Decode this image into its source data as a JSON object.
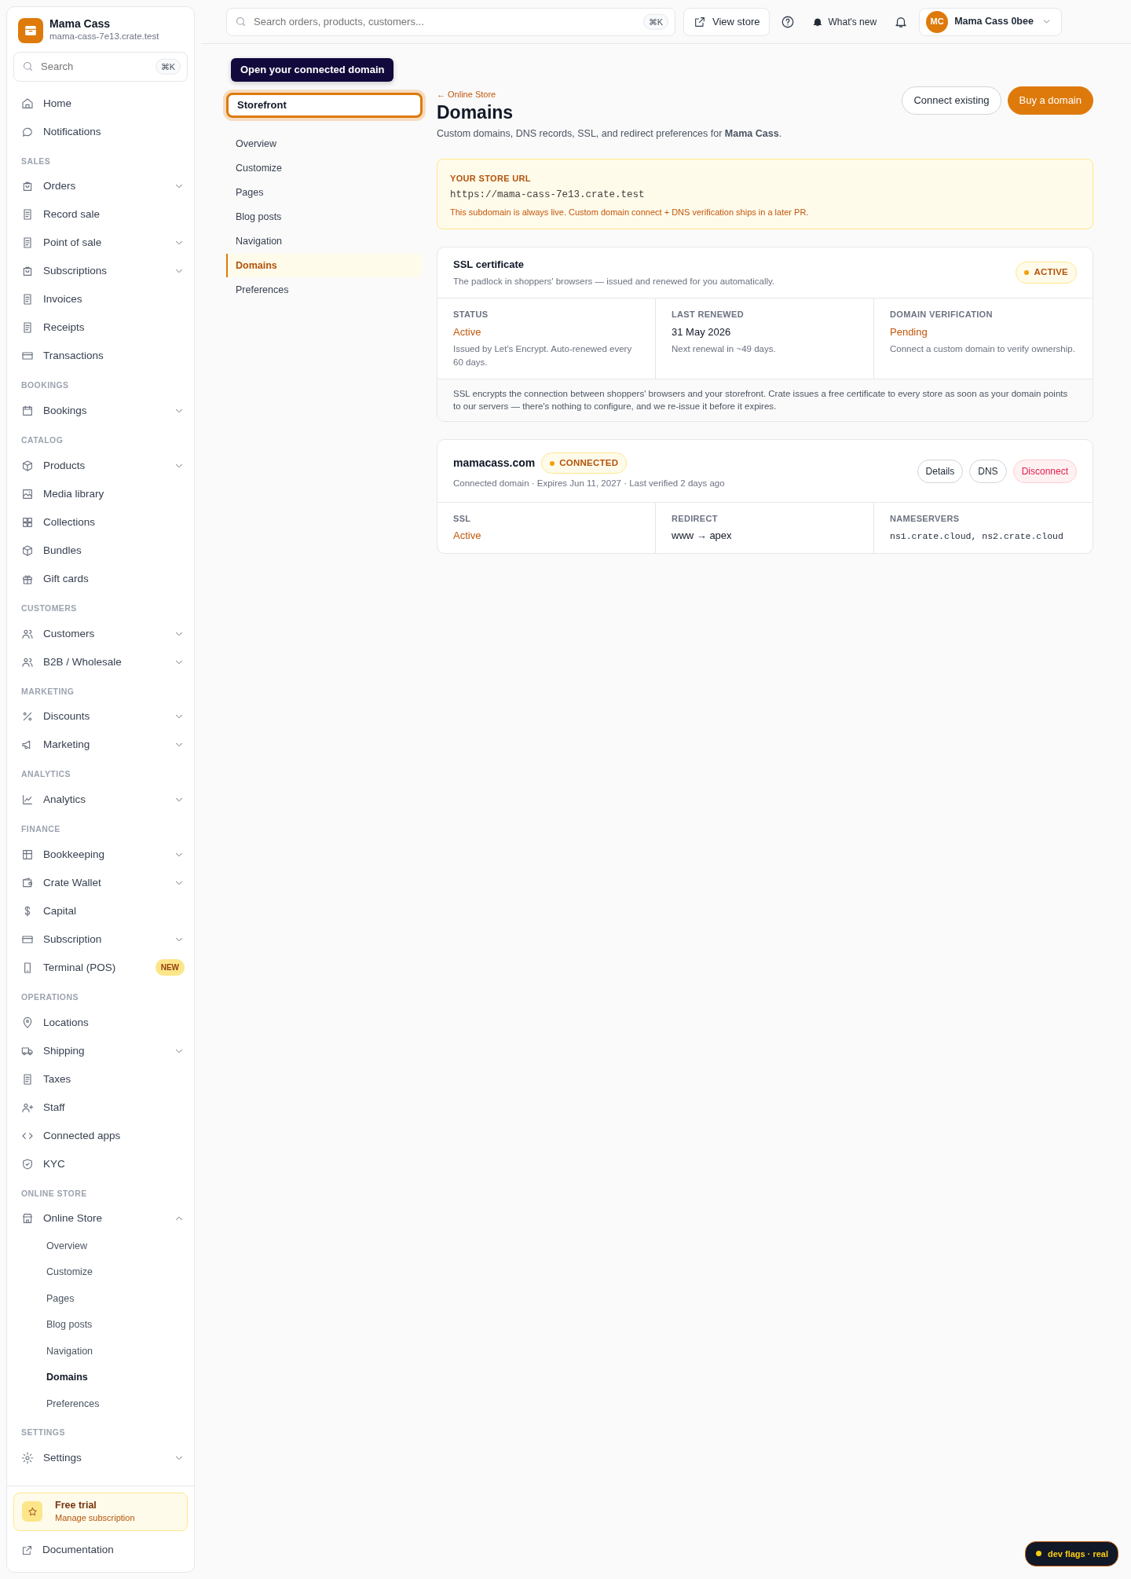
{
  "sidebar": {
    "store": {
      "name": "Mama Cass",
      "url": "mama-cass-7e13.crate.test"
    },
    "search": {
      "placeholder": "Search",
      "shortcut": "⌘K"
    },
    "sections": [
      {
        "items": [
          {
            "label": "Home",
            "selected": false
          },
          {
            "label": "Notifications",
            "selected": false
          }
        ]
      },
      {
        "label": "SALES",
        "items": [
          {
            "label": "Orders",
            "selected": false,
            "expanded": false
          },
          {
            "label": "Record sale",
            "selected": false
          },
          {
            "label": "Point of sale",
            "selected": false,
            "expanded": false
          },
          {
            "label": "Subscriptions",
            "selected": false,
            "expanded": false
          },
          {
            "label": "Invoices",
            "selected": false
          },
          {
            "label": "Receipts",
            "selected": false
          },
          {
            "label": "Transactions",
            "selected": false
          }
        ]
      },
      {
        "label": "BOOKINGS",
        "items": [
          {
            "label": "Bookings",
            "selected": false,
            "expanded": false
          }
        ]
      },
      {
        "label": "CATALOG",
        "items": [
          {
            "label": "Products",
            "selected": false,
            "expanded": false
          },
          {
            "label": "Media library",
            "selected": false
          },
          {
            "label": "Collections",
            "selected": false
          },
          {
            "label": "Bundles",
            "selected": false
          },
          {
            "label": "Gift cards",
            "selected": false
          }
        ]
      },
      {
        "label": "CUSTOMERS",
        "items": [
          {
            "label": "Customers",
            "selected": false,
            "expanded": false
          },
          {
            "label": "B2B / Wholesale",
            "selected": false,
            "expanded": false
          }
        ]
      },
      {
        "label": "MARKETING",
        "items": [
          {
            "label": "Discounts",
            "selected": false,
            "expanded": false
          },
          {
            "label": "Marketing",
            "selected": false,
            "expanded": false
          }
        ]
      },
      {
        "label": "ANALYTICS",
        "items": [
          {
            "label": "Analytics",
            "selected": false,
            "expanded": false
          }
        ]
      },
      {
        "label": "FINANCE",
        "items": [
          {
            "label": "Bookkeeping",
            "selected": false,
            "expanded": false
          },
          {
            "label": "Crate Wallet",
            "selected": false,
            "expanded": false
          },
          {
            "label": "Capital",
            "selected": false
          },
          {
            "label": "Subscription",
            "selected": false,
            "expanded": false
          },
          {
            "label": "Terminal (POS)",
            "selected": false,
            "badge": "NEW"
          }
        ]
      },
      {
        "label": "OPERATIONS",
        "items": [
          {
            "label": "Locations",
            "selected": false
          },
          {
            "label": "Shipping",
            "selected": false,
            "expanded": false
          },
          {
            "label": "Taxes",
            "selected": false
          },
          {
            "label": "Staff",
            "selected": false
          },
          {
            "label": "Connected apps",
            "selected": false
          },
          {
            "label": "KYC",
            "selected": false
          }
        ]
      },
      {
        "label": "ONLINE STORE",
        "items": [
          {
            "label": "Online Store",
            "selected": false,
            "expanded": true,
            "children": [
              {
                "label": "Overview",
                "selected": false
              },
              {
                "label": "Customize",
                "selected": false
              },
              {
                "label": "Pages",
                "selected": false
              },
              {
                "label": "Blog posts",
                "selected": false
              },
              {
                "label": "Navigation",
                "selected": false
              },
              {
                "label": "Domains",
                "selected": true
              },
              {
                "label": "Preferences",
                "selected": false
              }
            ]
          }
        ]
      },
      {
        "label": "SETTINGS",
        "items": [
          {
            "label": "Settings",
            "selected": false,
            "expanded": false
          }
        ]
      }
    ],
    "trial": {
      "title": "Free trial",
      "link": "Manage subscription"
    },
    "documentation": "Documentation"
  },
  "topbar": {
    "search": {
      "placeholder": "Search orders, products, customers...",
      "shortcut": "⌘K"
    },
    "view_store": "View store",
    "whats_new": "What's new",
    "user": {
      "initials": "MC",
      "name": "Mama Cass 0bee"
    }
  },
  "tooltip": "Open your connected domain",
  "subnav": {
    "storefront": "Storefront",
    "items": [
      {
        "label": "Overview",
        "selected": false
      },
      {
        "label": "Customize",
        "selected": false
      },
      {
        "label": "Pages",
        "selected": false
      },
      {
        "label": "Blog posts",
        "selected": false
      },
      {
        "label": "Navigation",
        "selected": false
      },
      {
        "label": "Domains",
        "selected": true
      },
      {
        "label": "Preferences",
        "selected": false
      }
    ]
  },
  "page": {
    "back": "← Online Store",
    "title": "Domains",
    "subtitle": "Custom domains, DNS records, SSL, and redirect preferences for **Mama Cass**.",
    "buttons": [
      {
        "label": "Connect existing",
        "kind": "outline"
      },
      {
        "label": "Buy a domain",
        "kind": "primary"
      }
    ]
  },
  "store_url": {
    "label": "YOUR STORE URL",
    "url": "https://mama-cass-7e13.crate.test",
    "note": "This subdomain is always live. Custom domain connect + DNS verification ships in a later PR."
  },
  "ssl": {
    "title": "SSL certificate",
    "subtitle": "The padlock in shoppers' browsers — issued and renewed for you automatically.",
    "badge": "ACTIVE",
    "fields": [
      {
        "label": "STATUS",
        "value": "Active",
        "kind": "accent",
        "note": "Issued by Let's Encrypt. Auto-renewed every 60 days."
      },
      {
        "label": "LAST RENEWED",
        "value": "31 May 2026",
        "kind": "plain",
        "note": "Next renewal in ~49 days."
      },
      {
        "label": "DOMAIN VERIFICATION",
        "value": "Pending",
        "kind": "accent",
        "note": "Connect a custom domain to verify ownership."
      }
    ],
    "footnote": "SSL encrypts the connection between shoppers' browsers and your storefront. Crate issues a free certificate to every store as soon as your domain points to our servers — there's nothing to configure, and we re-issue it before it expires."
  },
  "domain": {
    "name": "mamacass.com",
    "badge": "CONNECTED",
    "meta": "Connected domain · Expires Jun 11, 2027 · Last verified 2 days ago",
    "buttons": [
      {
        "label": "Details",
        "kind": "outline"
      },
      {
        "label": "DNS",
        "kind": "outline"
      },
      {
        "label": "Disconnect",
        "kind": "danger"
      }
    ],
    "fields": [
      {
        "label": "SSL",
        "value": "Active",
        "kind": "accent"
      },
      {
        "label": "REDIRECT",
        "value": "www → apex",
        "kind": "plain"
      },
      {
        "label": "NAMESERVERS",
        "value": "ns1.crate.cloud, ns2.crate.cloud",
        "kind": "mono"
      }
    ]
  },
  "dev_flags": "dev flags · real"
}
